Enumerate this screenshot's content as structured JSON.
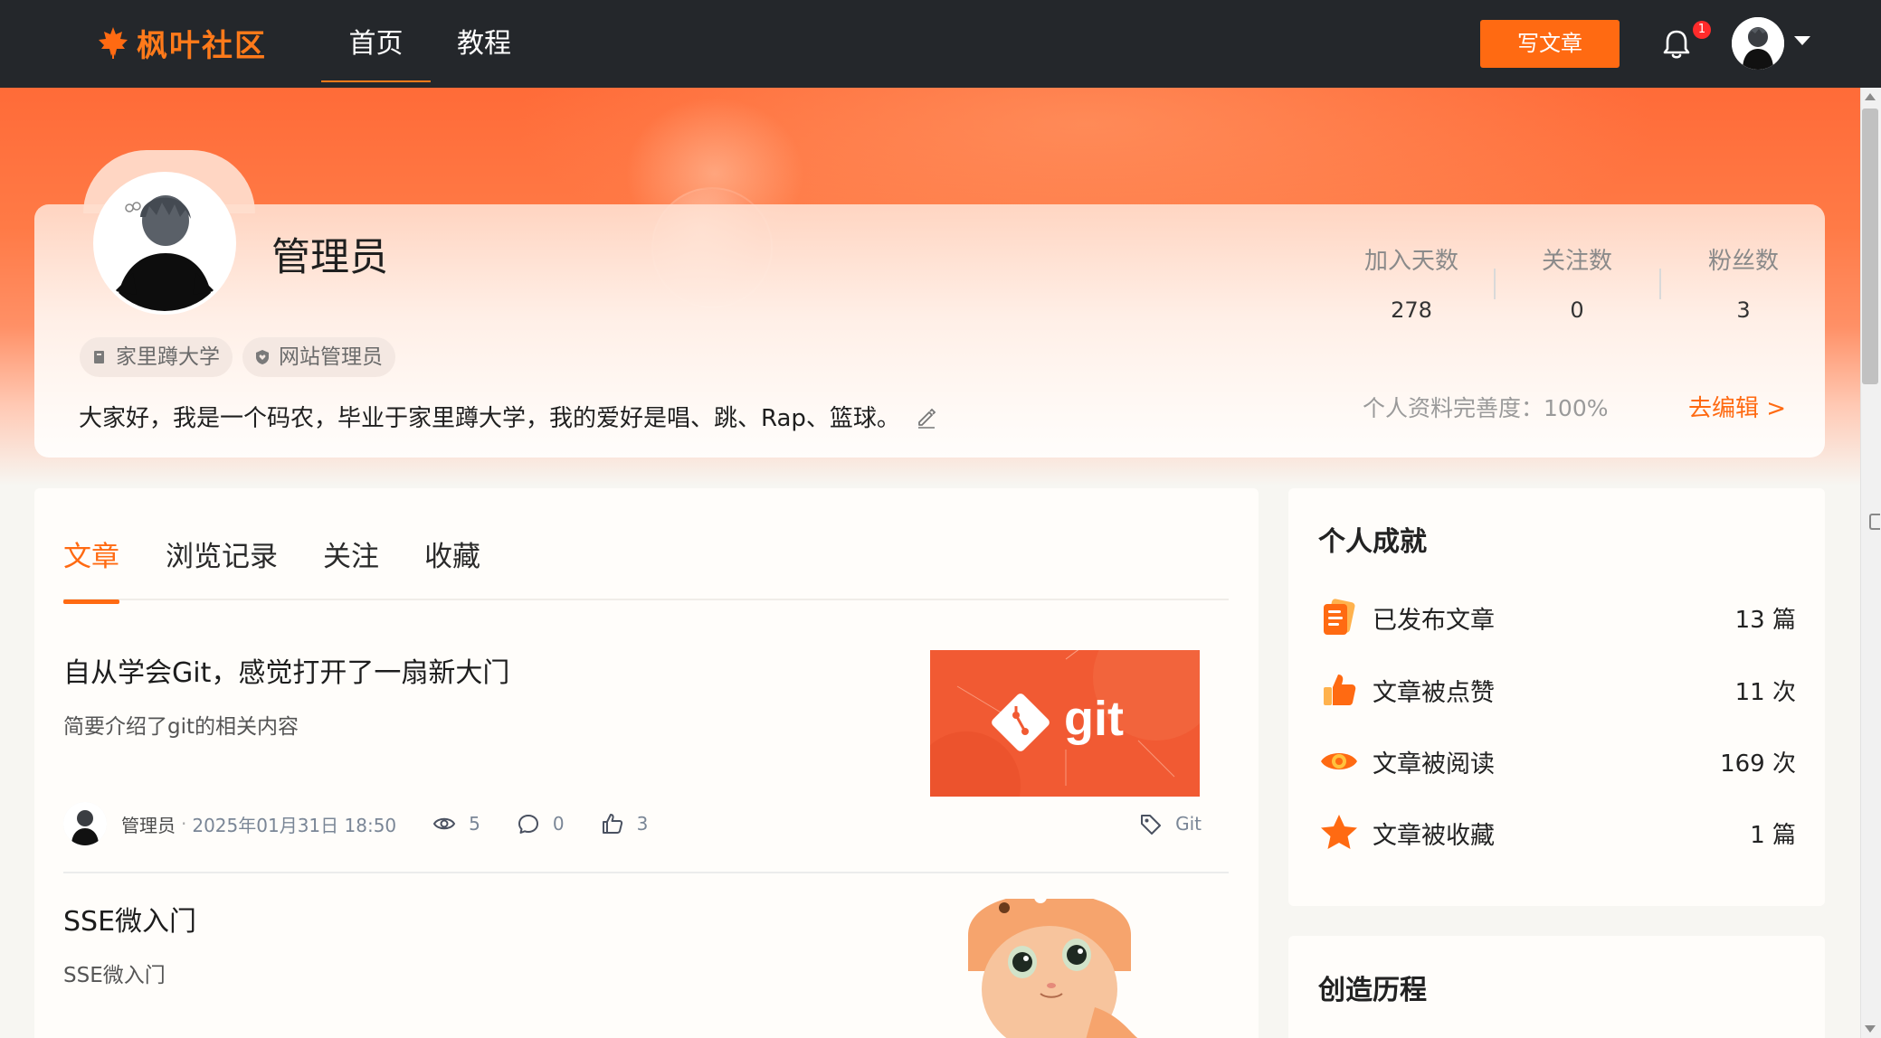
{
  "nav": {
    "logo_text": "枫叶社区",
    "tabs": [
      {
        "label": "首页",
        "active": true
      },
      {
        "label": "教程",
        "active": false
      }
    ],
    "write_button": "写文章",
    "notification_count": "1",
    "accent_color": "#ff6a12"
  },
  "profile": {
    "name": "管理员",
    "tags": [
      "家里蹲大学",
      "网站管理员"
    ],
    "bio": "大家好，我是一个码农，毕业于家里蹲大学，我的爱好是唱、跳、Rap、篮球。",
    "stats": [
      {
        "label": "加入天数",
        "value": "278"
      },
      {
        "label": "关注数",
        "value": "0"
      },
      {
        "label": "粉丝数",
        "value": "3"
      }
    ],
    "completeness_label": "个人资料完善度：",
    "completeness_value": "100%",
    "edit_link": "去编辑 >"
  },
  "content": {
    "tabs": [
      {
        "label": "文章",
        "active": true
      },
      {
        "label": "浏览记录",
        "active": false
      },
      {
        "label": "关注",
        "active": false
      },
      {
        "label": "收藏",
        "active": false
      }
    ],
    "articles": [
      {
        "title": "自从学会Git，感觉打开了一扇新大门",
        "summary": "简要介绍了git的相关内容",
        "thumbnail_text": "git",
        "author": "管理员",
        "date": "2025年01月31日 18:50",
        "views": "5",
        "comments": "0",
        "likes": "3",
        "tag": "Git"
      },
      {
        "title": "SSE微入门",
        "summary": "SSE微入门"
      }
    ]
  },
  "sidebar": {
    "achievements_title": "个人成就",
    "achievements": [
      {
        "label": "已发布文章",
        "value": "13 篇",
        "icon": "document-icon"
      },
      {
        "label": "文章被点赞",
        "value": "11 次",
        "icon": "thumbs-up-icon"
      },
      {
        "label": "文章被阅读",
        "value": "169 次",
        "icon": "eye-icon"
      },
      {
        "label": "文章被收藏",
        "value": "1 篇",
        "icon": "star-icon"
      }
    ],
    "history_title": "创造历程"
  }
}
